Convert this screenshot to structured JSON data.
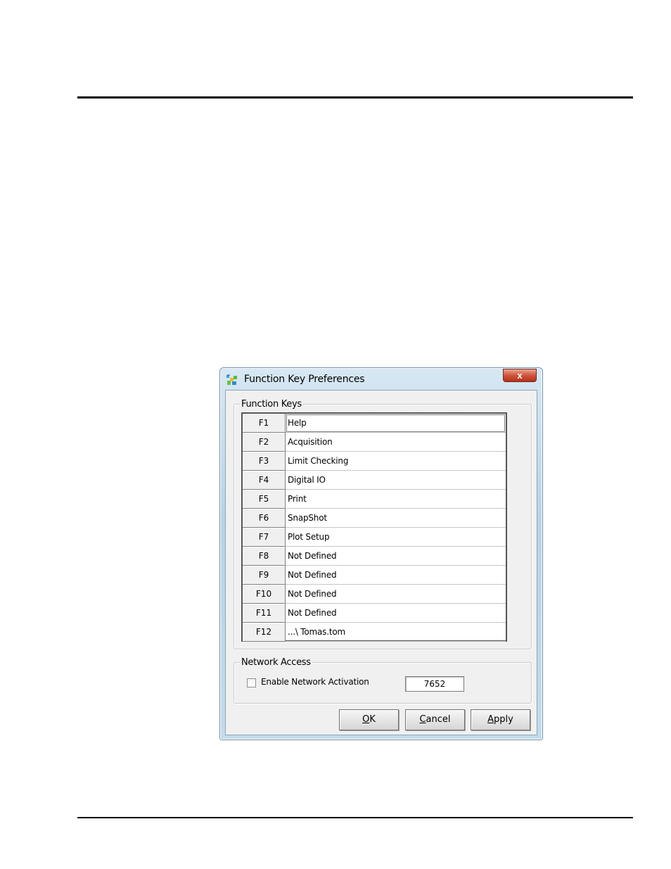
{
  "window": {
    "title": "Function Key Preferences",
    "close_glyph": "x"
  },
  "function_keys": {
    "legend": "Function Keys",
    "rows": [
      {
        "key": "F1",
        "value": "Help"
      },
      {
        "key": "F2",
        "value": "Acquisition"
      },
      {
        "key": "F3",
        "value": "Limit Checking"
      },
      {
        "key": "F4",
        "value": "Digital IO"
      },
      {
        "key": "F5",
        "value": "Print"
      },
      {
        "key": "F6",
        "value": "SnapShot"
      },
      {
        "key": "F7",
        "value": "Plot Setup"
      },
      {
        "key": "F8",
        "value": "Not Defined"
      },
      {
        "key": "F9",
        "value": "Not Defined"
      },
      {
        "key": "F10",
        "value": "Not Defined"
      },
      {
        "key": "F11",
        "value": "Not Defined"
      },
      {
        "key": "F12",
        "value": "...\\ Tomas.tom"
      }
    ]
  },
  "network": {
    "legend": "Network Access",
    "enable_label": "Enable Network Activation",
    "enabled": false,
    "port": "7652"
  },
  "buttons": {
    "ok_mnemonic": "O",
    "ok_rest": "K",
    "cancel_mnemonic": "C",
    "cancel_rest": "ancel",
    "apply_mnemonic": "A",
    "apply_rest": "pply"
  },
  "colors": {
    "title_bar": "#c4dbea",
    "close_button": "#d0553d",
    "client_background": "#f0f0f0"
  },
  "icons": {
    "app": "function-keys-app-icon",
    "close": "close-icon"
  }
}
